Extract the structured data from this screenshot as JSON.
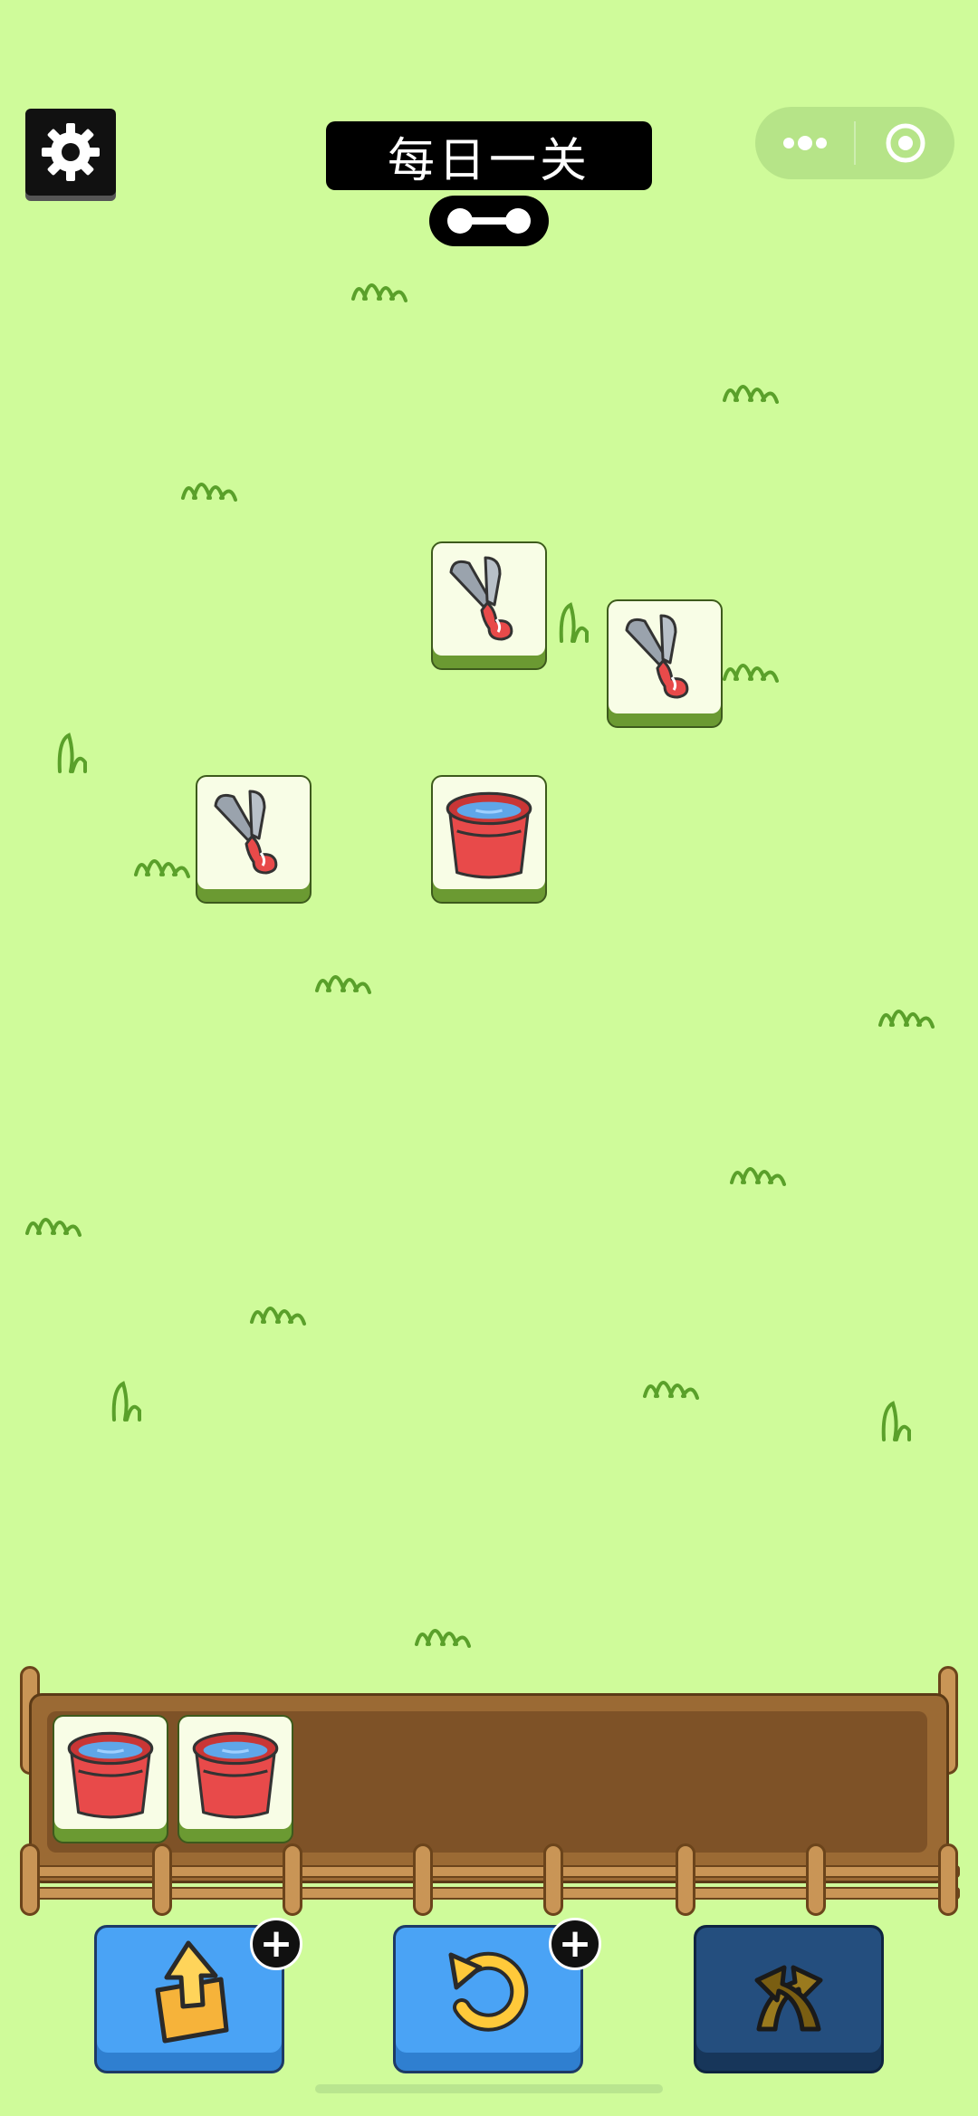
{
  "header": {
    "title": "每日一关",
    "settings_icon": "gear-icon",
    "progress_icon": "dumbbell-progress-icon",
    "capsule": {
      "more_icon": "more-dots-icon",
      "close_icon": "target-close-icon"
    }
  },
  "board": {
    "tiles": [
      {
        "item": "pruning-shears"
      },
      {
        "item": "pruning-shears"
      },
      {
        "item": "pruning-shears"
      },
      {
        "item": "red-bucket"
      }
    ]
  },
  "tray": {
    "capacity": 7,
    "slots": [
      {
        "item": "red-bucket"
      },
      {
        "item": "red-bucket"
      }
    ]
  },
  "tools": [
    {
      "name": "pop-out",
      "icon": "box-arrow-up-icon",
      "has_plus": true,
      "plus": "+"
    },
    {
      "name": "undo",
      "icon": "undo-icon",
      "has_plus": true,
      "plus": "+"
    },
    {
      "name": "shuffle",
      "icon": "shuffle-icon",
      "has_plus": false
    }
  ],
  "colors": {
    "background": "#cffb9a",
    "tile_face": "#f8fde6",
    "tile_side": "#6b9a32",
    "tool_blue": "#4aa3f5",
    "tool_dark": "#244e7e",
    "bucket_red": "#e84a4a",
    "bucket_water": "#5fa6e8"
  }
}
